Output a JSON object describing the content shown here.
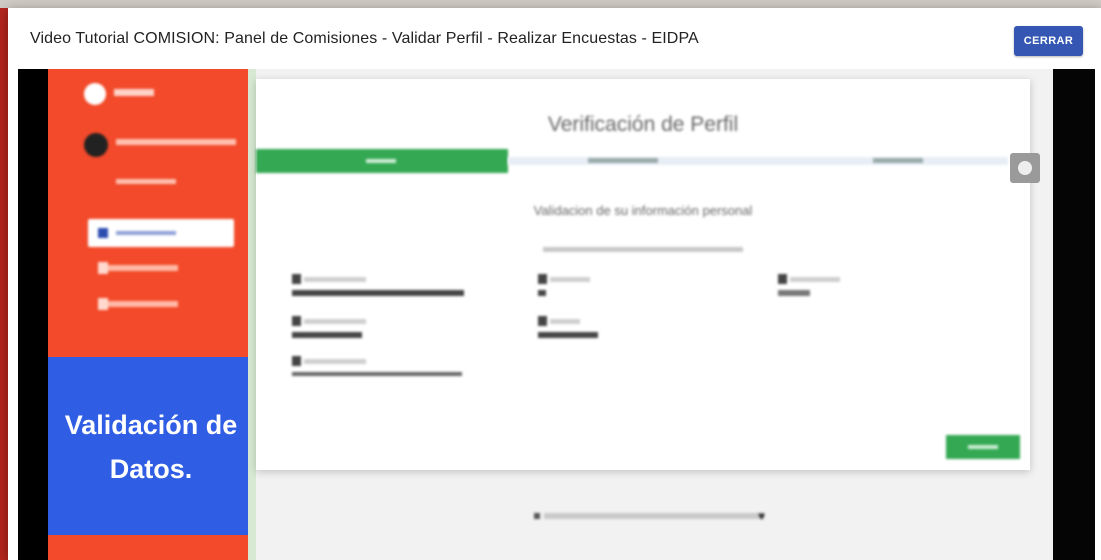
{
  "modal": {
    "title": "Video Tutorial COMISION: Panel de Comisiones - Validar Perfil - Realizar Encuestas - EIDPA",
    "close_label": "CERRAR"
  },
  "video": {
    "page_title": "Verificación de Perfil",
    "section_title": "Validacion de su información personal",
    "overlay_text": "Validación de Datos.",
    "sidebar_nav_count": 3
  },
  "colors": {
    "close_button": "#3557b3",
    "video_sidebar": "#f24a2a",
    "video_overlay": "#2f5de4",
    "step_active": "#34a853"
  }
}
